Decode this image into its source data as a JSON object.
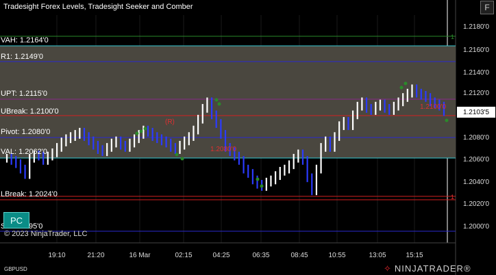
{
  "title": "Tradesight Forex Levels, Tradesight Seeker and Comber",
  "window_button": "F",
  "pc_button": "PC",
  "copyright": "© 2023 NinjaTrader, LLC",
  "instrument": "GBPUSD",
  "logo": {
    "icon": "ninjatrader-logo-icon",
    "text": "NINJATRADER",
    "trademark": "®"
  },
  "current_price": "1.2103'5",
  "levels": [
    {
      "label": "VAH: 1.2164'0",
      "price": 1.2164
    },
    {
      "label": "R1: 1.2149'0",
      "price": 1.2149
    },
    {
      "label": "UPT: 1.2115'0",
      "price": 1.2115
    },
    {
      "label": "UBreak: 1.2100'0",
      "price": 1.21
    },
    {
      "label": "Pivot: 1.2080'0",
      "price": 1.208
    },
    {
      "label": "VAL: 1.2062'0",
      "price": 1.2062
    },
    {
      "label": "LBreak: 1.2024'0",
      "price": 1.2024
    },
    {
      "label": "S1: 1.1995'0",
      "price": 1.1995
    }
  ],
  "price_axis": [
    "1.2180'0",
    "1.2160'0",
    "1.2140'0",
    "1.2120'0",
    "1.2080'0",
    "1.2060'0",
    "1.2040'0",
    "1.2020'0",
    "1.2000'0"
  ],
  "time_axis": [
    "19:10",
    "21:20",
    "16 Mar",
    "02:15",
    "04:25",
    "06:35",
    "08:45",
    "10:55",
    "13:05",
    "15:15"
  ],
  "annotations": [
    "(R)",
    "1.2080'0",
    "1.2100'0",
    "1"
  ],
  "colors": {
    "band": "#4a473f",
    "cyan": "#35c8d2",
    "blue": "#2a2ad0",
    "red": "#d42020",
    "green": "#2a8a2a"
  },
  "chart_data": {
    "type": "line",
    "ylim": [
      1.1982,
      1.2192
    ],
    "y": [
      1.206,
      1.2058,
      1.2055,
      1.205,
      1.2045,
      1.206,
      1.2063,
      1.2062,
      1.2058,
      1.2062,
      1.2065,
      1.207,
      1.2075,
      1.2078,
      1.208,
      1.2082,
      1.2084,
      1.208,
      1.2076,
      1.2072,
      1.2068,
      1.2066,
      1.207,
      1.2074,
      1.2076,
      1.2072,
      1.207,
      1.2074,
      1.2078,
      1.2082,
      1.2086,
      1.2084,
      1.208,
      1.2078,
      1.2076,
      1.2074,
      1.207,
      1.2068,
      1.2072,
      1.2076,
      1.208,
      1.2086,
      1.2096,
      1.2106,
      1.2112,
      1.21,
      1.2092,
      1.2082,
      1.207,
      1.2066,
      1.2062,
      1.2058,
      1.205,
      1.2046,
      1.204,
      1.2036,
      1.2034,
      1.2038,
      1.204,
      1.2044,
      1.2048,
      1.205,
      1.2054,
      1.206,
      1.2064,
      1.2058,
      1.2042,
      1.203,
      1.205,
      1.207,
      1.2076,
      1.207,
      1.208,
      1.209,
      1.2094,
      1.209,
      1.21,
      1.2108,
      1.2112,
      1.2106,
      1.2104,
      1.2108,
      1.211,
      1.2106,
      1.2104,
      1.2108,
      1.2112,
      1.2116,
      1.212,
      1.2124,
      1.212,
      1.2118,
      1.2116,
      1.2112,
      1.211,
      1.2108,
      1.2103
    ]
  }
}
